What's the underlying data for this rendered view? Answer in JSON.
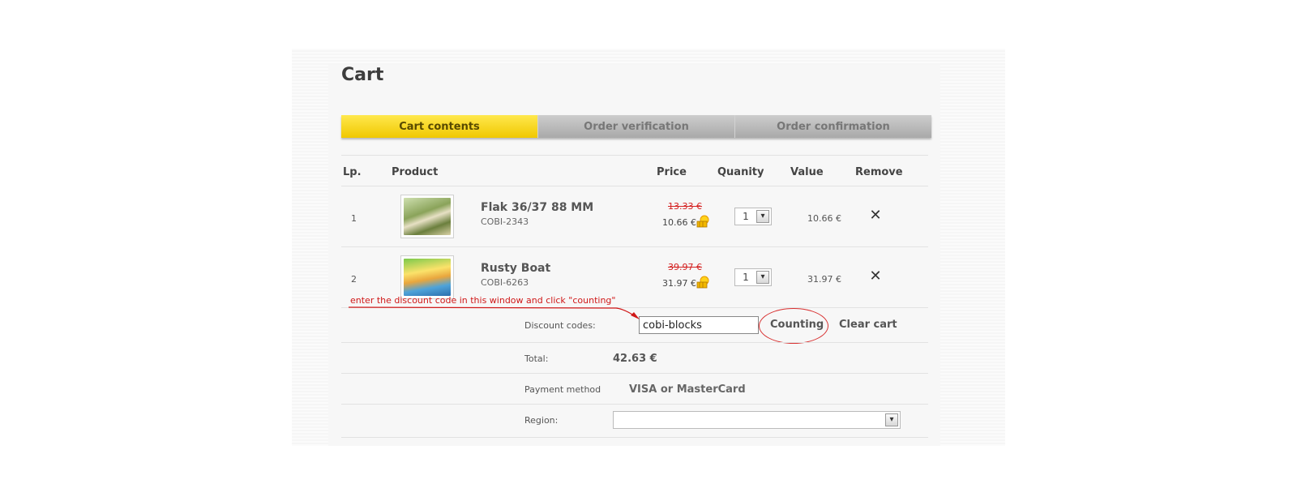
{
  "page": {
    "title": "Cart"
  },
  "steps": [
    {
      "label": "Cart contents",
      "active": true
    },
    {
      "label": "Order verification",
      "active": false
    },
    {
      "label": "Order confirmation",
      "active": false
    }
  ],
  "table": {
    "headers": {
      "lp": "Lp.",
      "product": "Product",
      "price": "Price",
      "quantity": "Quanity",
      "value": "Value",
      "remove": "Remove"
    },
    "rows": [
      {
        "lp": "1",
        "name": "Flak 36/37 88 MM",
        "code": "COBI-2343",
        "old_price": "13.33 €",
        "price": "10.66 €",
        "qty": "1",
        "value": "10.66 €"
      },
      {
        "lp": "2",
        "name": "Rusty Boat",
        "code": "COBI-6263",
        "old_price": "39.97 €",
        "price": "31.97 €",
        "qty": "1",
        "value": "31.97 €"
      }
    ],
    "remove_icon": "close-icon"
  },
  "annotation": {
    "text": "enter the discount code in this window and click \"counting\"",
    "color": "#d01818"
  },
  "discount": {
    "label": "Discount codes:",
    "value": "cobi-blocks",
    "counting_label": "Counting",
    "clear_label": "Clear cart"
  },
  "total": {
    "label": "Total:",
    "value": "42.63 €"
  },
  "payment": {
    "label": "Payment method",
    "value": "VISA or MasterCard"
  },
  "region": {
    "label": "Region:",
    "value": ""
  },
  "colors": {
    "accent": "#f5d000",
    "alert": "#d42020"
  }
}
